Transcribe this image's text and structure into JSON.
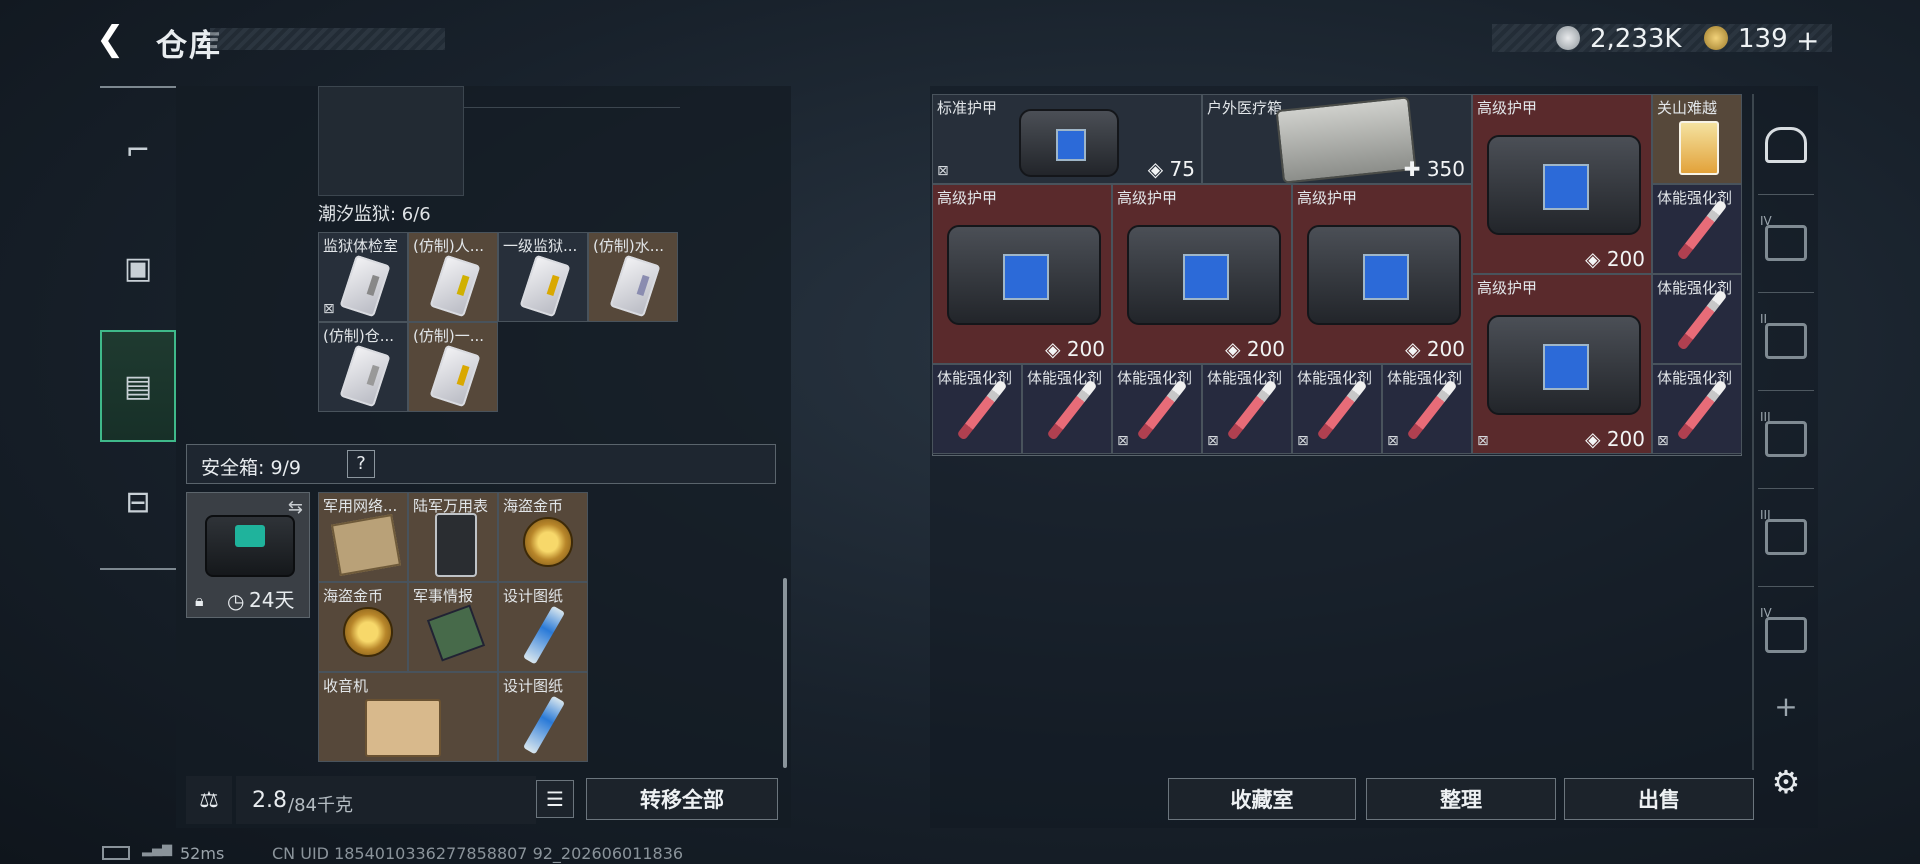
{
  "header": {
    "title": "仓库",
    "currency": [
      {
        "icon": "silver-coin-icon",
        "value": "2,233K"
      },
      {
        "icon": "gold-coin-icon",
        "value": "139"
      }
    ],
    "add_label": "+"
  },
  "left_nav": [
    {
      "icon": "pistol-icon"
    },
    {
      "icon": "backpack-icon"
    },
    {
      "icon": "vest-icon",
      "active": true
    },
    {
      "icon": "toolbox-icon"
    }
  ],
  "left_panel": {
    "prison": {
      "label": "潮汐监狱: 6/6",
      "items": [
        {
          "label": "监狱体检室",
          "bg": "dark",
          "strip": "#888"
        },
        {
          "label": "(仿制)人...",
          "bg": "brown",
          "strip": "#d0b000"
        },
        {
          "label": "一级监狱...",
          "bg": "dark",
          "strip": "#d9a800"
        },
        {
          "label": "(仿制)水...",
          "bg": "brown",
          "strip": "#8a8cb0"
        },
        {
          "label": "(仿制)仓...",
          "bg": "dark",
          "strip": "#999"
        },
        {
          "label": "(仿制)一...",
          "bg": "brown",
          "strip": "#d9a800"
        }
      ]
    },
    "safe_box": {
      "label": "安全箱: 9/9",
      "help": "?",
      "days": "24天",
      "items": [
        {
          "label": "军用网络..."
        },
        {
          "label": "陆军万用表"
        },
        {
          "label": "海盗金币"
        },
        {
          "label": "海盗金币"
        },
        {
          "label": "军事情报"
        },
        {
          "label": "设计图纸"
        },
        {
          "label": "收音机"
        },
        {
          "label": "设计图纸"
        }
      ]
    },
    "weight": {
      "current": "2.8",
      "max": "/84千克"
    },
    "transfer_all": "转移全部"
  },
  "right_panel": {
    "items": {
      "standard_armor": {
        "label": "标准护甲",
        "value": "75"
      },
      "medkit": {
        "label": "户外医疗箱",
        "value": "350"
      },
      "adv_armor_label": "高级护甲",
      "adv_armor_value": "200",
      "drink": {
        "label": "关山难越"
      },
      "stim_label": "体能强化剂"
    },
    "buttons": {
      "collection": "收藏室",
      "sort": "整理",
      "sell": "出售"
    }
  },
  "right_nav": [
    {
      "icon": "helmet-icon"
    },
    {
      "icon": "armor-iv-icon",
      "tier": "IV"
    },
    {
      "icon": "medkit-ii-icon",
      "tier": "II"
    },
    {
      "icon": "gun-iii-icon",
      "tier": "III"
    },
    {
      "icon": "armor-iii-icon",
      "tier": "III"
    },
    {
      "icon": "folder-iv-icon",
      "tier": "IV"
    }
  ],
  "footer": {
    "latency": "52ms",
    "uid": "CN UID 1854010336277858807 92_202606011836"
  }
}
